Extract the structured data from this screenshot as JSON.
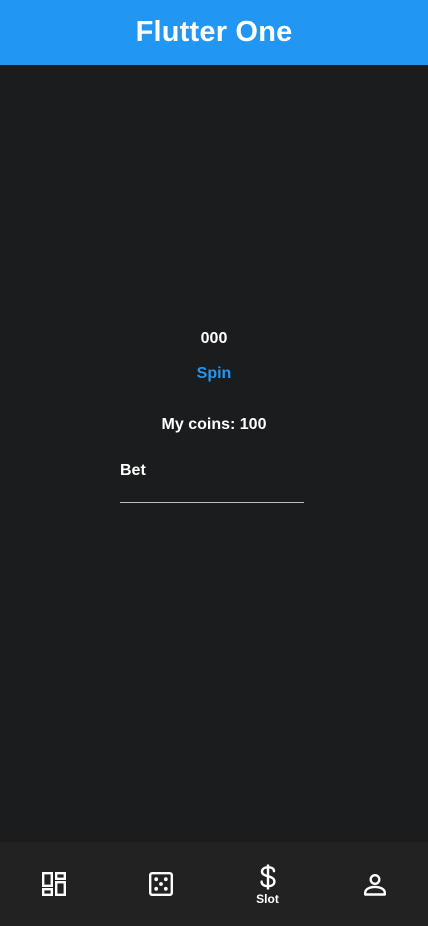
{
  "app_bar": {
    "title": "Flutter One"
  },
  "slot": {
    "result": "000",
    "spin_label": "Spin",
    "coins_text": "My coins: 100",
    "bet_label": "Bet",
    "bet_value": ""
  },
  "bottom_nav": {
    "items": [
      {
        "icon": "dashboard-icon",
        "label": ""
      },
      {
        "icon": "dice-icon",
        "label": ""
      },
      {
        "icon": "dollar-icon",
        "label": "Slot",
        "selected": true
      },
      {
        "icon": "person-icon",
        "label": ""
      }
    ]
  },
  "colors": {
    "primary": "#2196f3",
    "background": "#1b1c1e",
    "nav_background": "#222222",
    "text": "#ffffff"
  }
}
